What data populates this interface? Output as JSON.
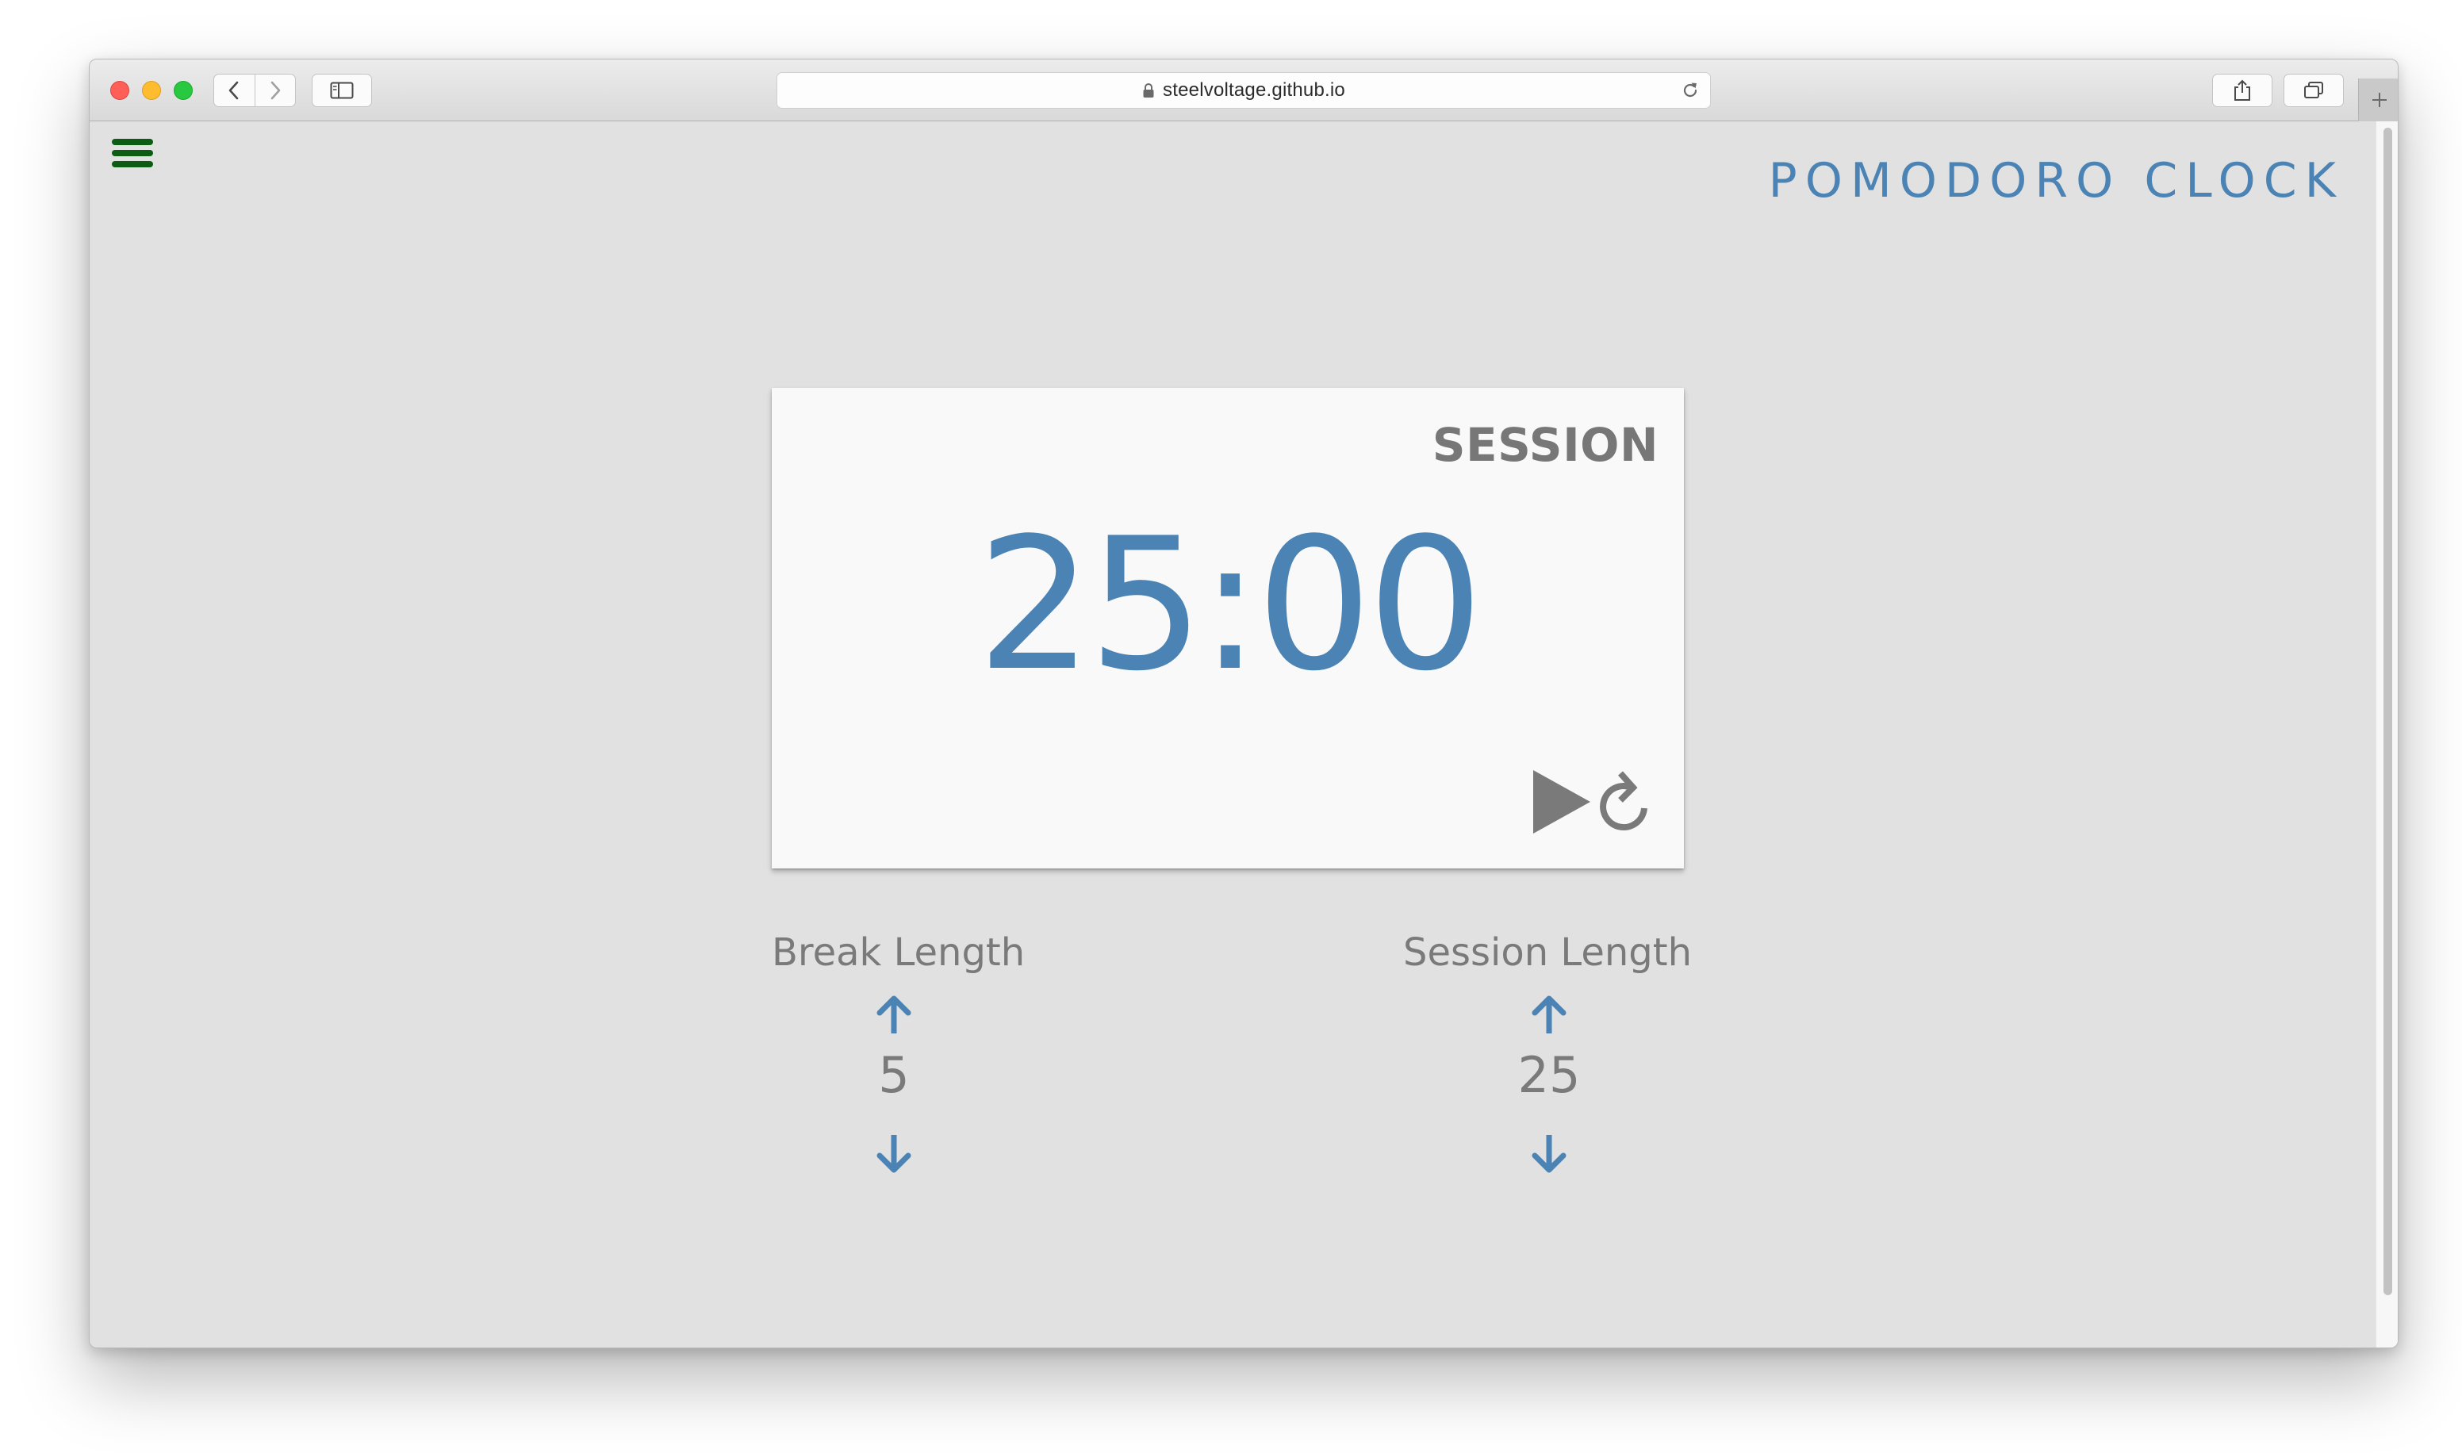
{
  "browser": {
    "url": "steelvoltage.github.io"
  },
  "app": {
    "title": "POMODORO CLOCK",
    "mode": "SESSION",
    "timer": "25:00",
    "accent_color": "#4a83b4",
    "menu_color": "#0d5c13"
  },
  "break": {
    "label": "Break Length",
    "value": "5"
  },
  "session": {
    "label": "Session Length",
    "value": "25"
  }
}
